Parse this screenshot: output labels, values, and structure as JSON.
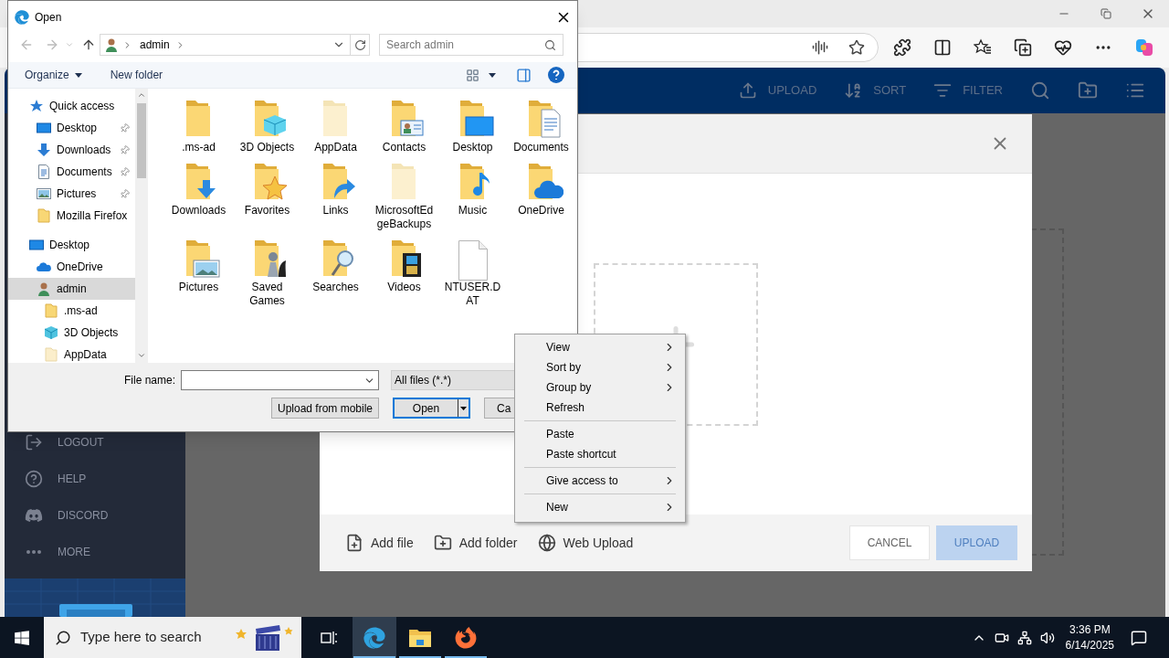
{
  "app": {
    "header_actions": [
      {
        "kind": "upload",
        "label": "UPLOAD"
      },
      {
        "kind": "sort",
        "label": "SORT"
      },
      {
        "kind": "filter",
        "label": "FILTER"
      },
      {
        "kind": "search"
      },
      {
        "kind": "new_folder"
      },
      {
        "kind": "list"
      }
    ],
    "sidebar": [
      {
        "kind": "logout",
        "label": "LOGOUT"
      },
      {
        "kind": "help",
        "label": "HELP"
      },
      {
        "kind": "discord",
        "label": "DISCORD"
      },
      {
        "kind": "more",
        "label": "MORE"
      }
    ],
    "upload_modal": {
      "footer_actions": [
        {
          "kind": "file",
          "label": "Add file"
        },
        {
          "kind": "folder",
          "label": "Add folder"
        },
        {
          "kind": "web",
          "label": "Web Upload"
        }
      ],
      "cancel": "CANCEL",
      "upload": {
        "label": "UPLOAD",
        "disabled": true
      }
    }
  },
  "dialog": {
    "title": "Open",
    "path": [
      "admin"
    ],
    "search_placeholder": "Search admin",
    "organize": "Organize",
    "new_folder": "New folder",
    "nav": [
      {
        "label": "Quick access",
        "kind": "quick",
        "pinned": false,
        "selected": false,
        "children": [
          {
            "label": "Desktop",
            "kind": "desktop",
            "pinned": true,
            "selected": false
          },
          {
            "label": "Downloads",
            "kind": "downloads",
            "pinned": true,
            "selected": false
          },
          {
            "label": "Documents",
            "kind": "documents",
            "pinned": true,
            "selected": false
          },
          {
            "label": "Pictures",
            "kind": "pictures",
            "pinned": true,
            "selected": false
          },
          {
            "label": "Mozilla Firefox",
            "kind": "folder",
            "pinned": false,
            "selected": false
          }
        ]
      },
      {
        "label": "Desktop",
        "kind": "desktop",
        "pinned": false,
        "selected": false,
        "children": [
          {
            "label": "OneDrive",
            "kind": "onedrive",
            "pinned": false,
            "selected": false
          },
          {
            "label": "admin",
            "kind": "user",
            "pinned": false,
            "selected": true,
            "children": [
              {
                "label": ".ms-ad",
                "kind": "folder",
                "pinned": false,
                "selected": false
              },
              {
                "label": "3D Objects",
                "kind": "cube",
                "pinned": false,
                "selected": false
              },
              {
                "label": "AppData",
                "kind": "hidden_folder",
                "pinned": false,
                "selected": false
              }
            ]
          }
        ]
      }
    ],
    "files": [
      {
        "label": ".ms-ad",
        "kind": "folder"
      },
      {
        "label": "3D Objects",
        "kind": "cube"
      },
      {
        "label": "AppData",
        "kind": "hidden"
      },
      {
        "label": "Contacts",
        "kind": "contacts"
      },
      {
        "label": "Desktop",
        "kind": "desktop"
      },
      {
        "label": "Documents",
        "kind": "documents"
      },
      {
        "label": "Downloads",
        "kind": "downloads"
      },
      {
        "label": "Favorites",
        "kind": "favorites"
      },
      {
        "label": "Links",
        "kind": "links"
      },
      {
        "label": "MicrosoftEdgeBackups",
        "kind": "hidden"
      },
      {
        "label": "Music",
        "kind": "music"
      },
      {
        "label": "OneDrive",
        "kind": "onedrive"
      },
      {
        "label": "Pictures",
        "kind": "pictures"
      },
      {
        "label": "Saved Games",
        "kind": "games"
      },
      {
        "label": "Searches",
        "kind": "searches"
      },
      {
        "label": "Videos",
        "kind": "videos"
      },
      {
        "label": "NTUSER.DAT",
        "kind": "file"
      }
    ],
    "file_name_label": "File name:",
    "file_type": "All files (*.*)",
    "buttons": [
      {
        "label": "Upload from mobile",
        "default": false,
        "split": false
      },
      {
        "label": "Open",
        "default": true,
        "split": true
      },
      {
        "label": "Ca",
        "default": false,
        "split": false
      }
    ]
  },
  "context_menu": [
    {
      "kind": "item",
      "label": "View",
      "submenu": true
    },
    {
      "kind": "item",
      "label": "Sort by",
      "submenu": true
    },
    {
      "kind": "item",
      "label": "Group by",
      "submenu": true
    },
    {
      "kind": "item",
      "label": "Refresh",
      "submenu": false
    },
    {
      "kind": "separator"
    },
    {
      "kind": "item",
      "label": "Paste",
      "submenu": false
    },
    {
      "kind": "item",
      "label": "Paste shortcut",
      "submenu": false
    },
    {
      "kind": "separator"
    },
    {
      "kind": "item",
      "label": "Give access to",
      "submenu": true
    },
    {
      "kind": "separator"
    },
    {
      "kind": "item",
      "label": "New",
      "submenu": true
    }
  ],
  "taskbar": {
    "search_placeholder": "Type here to search",
    "apps": [
      {
        "kind": "edge",
        "selected": true
      },
      {
        "kind": "explorer",
        "selected": false
      },
      {
        "kind": "firefox",
        "selected": false
      }
    ],
    "time": "3:36 PM",
    "date": "6/14/2025"
  }
}
